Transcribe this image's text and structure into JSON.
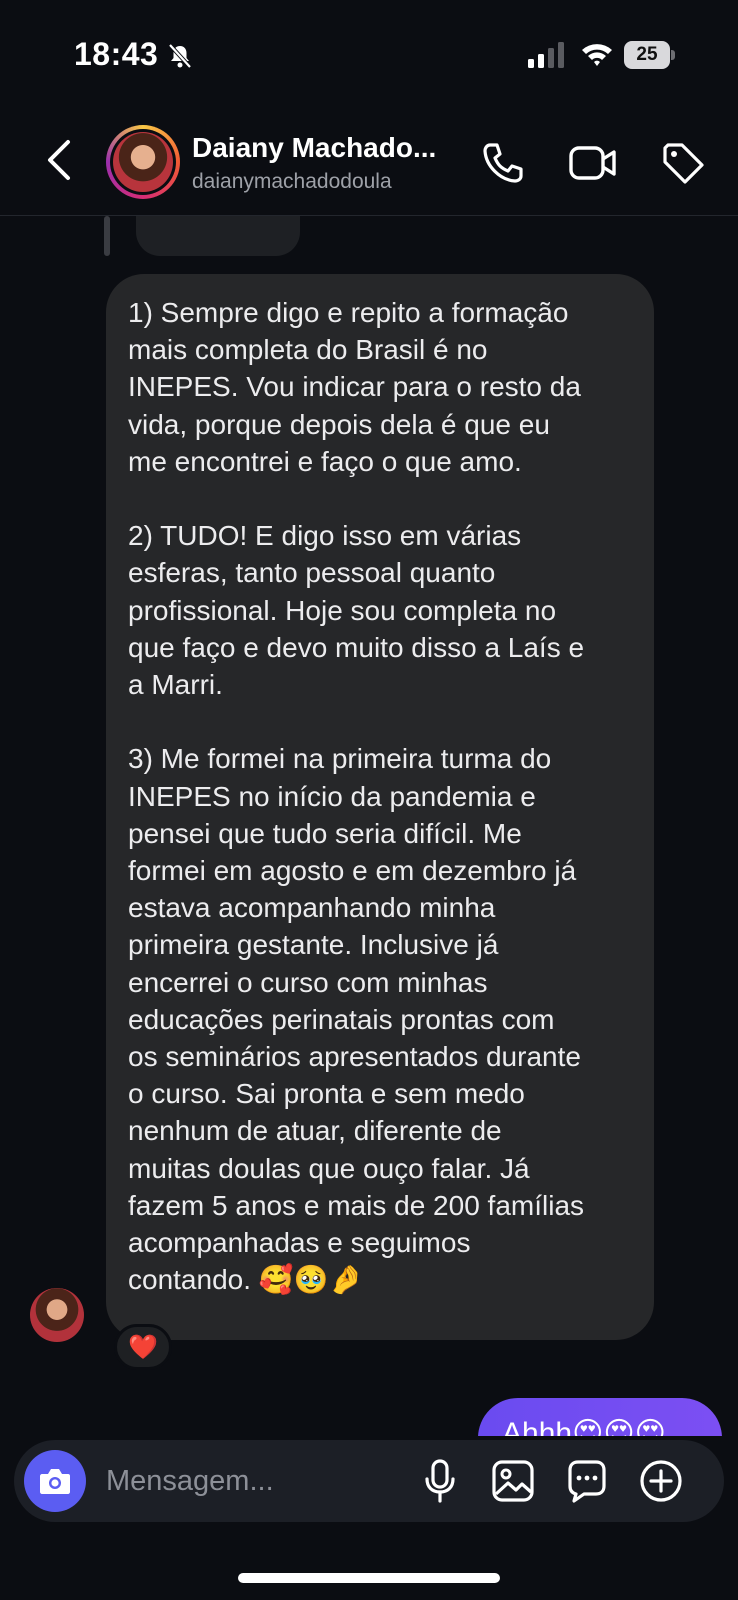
{
  "status_bar": {
    "time": "18:43",
    "battery": "25"
  },
  "header": {
    "contact_name": "Daiany Machado...",
    "contact_username": "daianymachadodoula"
  },
  "messages": {
    "incoming_text": "1) Sempre digo e repito a formação\nmais completa do Brasil é no\nINEPES. Vou indicar para o resto da\nvida, porque depois dela é que eu\nme encontrei e faço o que amo.\n\n2) TUDO! E digo isso em várias\nesferas, tanto pessoal quanto\nprofissional. Hoje sou completa no\nque faço e devo muito disso a Laís e\na Marri.\n\n3) Me formei na primeira turma do\nINEPES no início da pandemia e\npensei que tudo seria difícil. Me\nformei em agosto e em dezembro já\nestava acompanhando minha\nprimeira gestante. Inclusive já\nencerrei o curso com minhas\neducações perinatais prontas com\nos seminários apresentados durante\no curso. Sai pronta e sem medo\nnenhum de atuar, diferente de\nmuitas doulas que ouço falar. Já\nfazem 5 anos e mais de 200 famílias\nacompanhadas e seguimos\ncontando. 🥰🥹🤌",
    "reaction": "❤️",
    "outgoing_text": "Ahhh😍😍😍"
  },
  "composer": {
    "placeholder": "Mensagem..."
  },
  "colors": {
    "background": "#0b0d12",
    "incoming_bubble": "#262729",
    "outgoing_bubble": "#7c4ff3",
    "camera_button": "#5b5df2"
  },
  "icons": [
    "bell-off-icon",
    "signal-icon",
    "wifi-icon",
    "back-icon",
    "call-icon",
    "video-icon",
    "tag-icon",
    "camera-icon",
    "mic-icon",
    "gallery-icon",
    "sticker-icon",
    "plus-icon"
  ]
}
